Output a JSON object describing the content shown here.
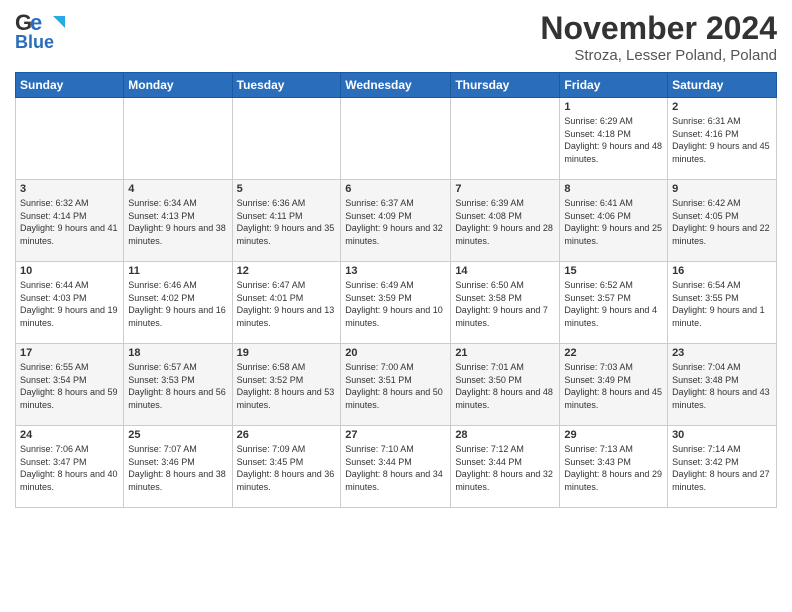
{
  "header": {
    "logo_line1": "General",
    "logo_line2": "Blue",
    "month": "November 2024",
    "location": "Stroza, Lesser Poland, Poland"
  },
  "days_of_week": [
    "Sunday",
    "Monday",
    "Tuesday",
    "Wednesday",
    "Thursday",
    "Friday",
    "Saturday"
  ],
  "weeks": [
    [
      {
        "day": "",
        "info": ""
      },
      {
        "day": "",
        "info": ""
      },
      {
        "day": "",
        "info": ""
      },
      {
        "day": "",
        "info": ""
      },
      {
        "day": "",
        "info": ""
      },
      {
        "day": "1",
        "info": "Sunrise: 6:29 AM\nSunset: 4:18 PM\nDaylight: 9 hours and 48 minutes."
      },
      {
        "day": "2",
        "info": "Sunrise: 6:31 AM\nSunset: 4:16 PM\nDaylight: 9 hours and 45 minutes."
      }
    ],
    [
      {
        "day": "3",
        "info": "Sunrise: 6:32 AM\nSunset: 4:14 PM\nDaylight: 9 hours and 41 minutes."
      },
      {
        "day": "4",
        "info": "Sunrise: 6:34 AM\nSunset: 4:13 PM\nDaylight: 9 hours and 38 minutes."
      },
      {
        "day": "5",
        "info": "Sunrise: 6:36 AM\nSunset: 4:11 PM\nDaylight: 9 hours and 35 minutes."
      },
      {
        "day": "6",
        "info": "Sunrise: 6:37 AM\nSunset: 4:09 PM\nDaylight: 9 hours and 32 minutes."
      },
      {
        "day": "7",
        "info": "Sunrise: 6:39 AM\nSunset: 4:08 PM\nDaylight: 9 hours and 28 minutes."
      },
      {
        "day": "8",
        "info": "Sunrise: 6:41 AM\nSunset: 4:06 PM\nDaylight: 9 hours and 25 minutes."
      },
      {
        "day": "9",
        "info": "Sunrise: 6:42 AM\nSunset: 4:05 PM\nDaylight: 9 hours and 22 minutes."
      }
    ],
    [
      {
        "day": "10",
        "info": "Sunrise: 6:44 AM\nSunset: 4:03 PM\nDaylight: 9 hours and 19 minutes."
      },
      {
        "day": "11",
        "info": "Sunrise: 6:46 AM\nSunset: 4:02 PM\nDaylight: 9 hours and 16 minutes."
      },
      {
        "day": "12",
        "info": "Sunrise: 6:47 AM\nSunset: 4:01 PM\nDaylight: 9 hours and 13 minutes."
      },
      {
        "day": "13",
        "info": "Sunrise: 6:49 AM\nSunset: 3:59 PM\nDaylight: 9 hours and 10 minutes."
      },
      {
        "day": "14",
        "info": "Sunrise: 6:50 AM\nSunset: 3:58 PM\nDaylight: 9 hours and 7 minutes."
      },
      {
        "day": "15",
        "info": "Sunrise: 6:52 AM\nSunset: 3:57 PM\nDaylight: 9 hours and 4 minutes."
      },
      {
        "day": "16",
        "info": "Sunrise: 6:54 AM\nSunset: 3:55 PM\nDaylight: 9 hours and 1 minute."
      }
    ],
    [
      {
        "day": "17",
        "info": "Sunrise: 6:55 AM\nSunset: 3:54 PM\nDaylight: 8 hours and 59 minutes."
      },
      {
        "day": "18",
        "info": "Sunrise: 6:57 AM\nSunset: 3:53 PM\nDaylight: 8 hours and 56 minutes."
      },
      {
        "day": "19",
        "info": "Sunrise: 6:58 AM\nSunset: 3:52 PM\nDaylight: 8 hours and 53 minutes."
      },
      {
        "day": "20",
        "info": "Sunrise: 7:00 AM\nSunset: 3:51 PM\nDaylight: 8 hours and 50 minutes."
      },
      {
        "day": "21",
        "info": "Sunrise: 7:01 AM\nSunset: 3:50 PM\nDaylight: 8 hours and 48 minutes."
      },
      {
        "day": "22",
        "info": "Sunrise: 7:03 AM\nSunset: 3:49 PM\nDaylight: 8 hours and 45 minutes."
      },
      {
        "day": "23",
        "info": "Sunrise: 7:04 AM\nSunset: 3:48 PM\nDaylight: 8 hours and 43 minutes."
      }
    ],
    [
      {
        "day": "24",
        "info": "Sunrise: 7:06 AM\nSunset: 3:47 PM\nDaylight: 8 hours and 40 minutes."
      },
      {
        "day": "25",
        "info": "Sunrise: 7:07 AM\nSunset: 3:46 PM\nDaylight: 8 hours and 38 minutes."
      },
      {
        "day": "26",
        "info": "Sunrise: 7:09 AM\nSunset: 3:45 PM\nDaylight: 8 hours and 36 minutes."
      },
      {
        "day": "27",
        "info": "Sunrise: 7:10 AM\nSunset: 3:44 PM\nDaylight: 8 hours and 34 minutes."
      },
      {
        "day": "28",
        "info": "Sunrise: 7:12 AM\nSunset: 3:44 PM\nDaylight: 8 hours and 32 minutes."
      },
      {
        "day": "29",
        "info": "Sunrise: 7:13 AM\nSunset: 3:43 PM\nDaylight: 8 hours and 29 minutes."
      },
      {
        "day": "30",
        "info": "Sunrise: 7:14 AM\nSunset: 3:42 PM\nDaylight: 8 hours and 27 minutes."
      }
    ]
  ]
}
